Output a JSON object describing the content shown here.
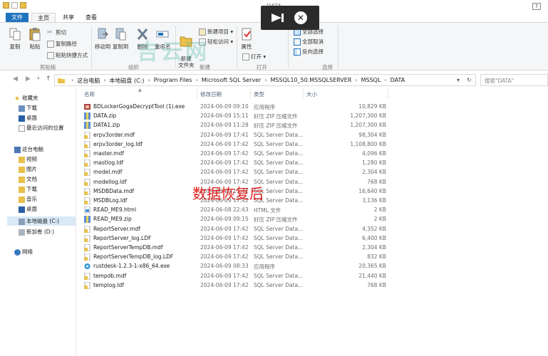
{
  "window": {
    "title": "DATA"
  },
  "ribbon_tabs": [
    "文件",
    "主页",
    "共享",
    "查看"
  ],
  "ribbon": {
    "copy": "复制",
    "paste": "粘贴",
    "cut": "剪切",
    "copy_path": "复制路径",
    "paste_shortcut": "粘贴快捷方式",
    "move_to": "移动到",
    "copy_to": "复制到",
    "delete": "删除",
    "rename": "重命名",
    "new_folder": "新建\n文件夹",
    "new_item": "新建项目",
    "easy_access": "轻松访问",
    "properties": "属性",
    "open": "打开",
    "select_all": "全部选择",
    "select_none": "全部取消",
    "invert_selection": "反向选择",
    "group_clipboard": "剪贴板",
    "group_organize": "组织",
    "group_new": "新建",
    "group_open": "打开",
    "group_select": "选择"
  },
  "overlay": {
    "close_glyph": "✕"
  },
  "watermark": "吉云网",
  "address": {
    "crumbs": [
      "这台电脑",
      "本地磁盘 (C:)",
      "Program Files",
      "Microsoft SQL Server",
      "MSSQL10_50.MSSQLSERVER",
      "MSSQL",
      "DATA"
    ],
    "search_placeholder": "搜索\"DATA\""
  },
  "nav": {
    "favorites": "收藏夹",
    "downloads": "下载",
    "desktop": "桌面",
    "recent": "最近访问的位置",
    "this_pc": "这台电脑",
    "videos": "视频",
    "pictures": "图片",
    "documents": "文档",
    "downloads2": "下载",
    "music": "音乐",
    "desktop2": "桌面",
    "local_c": "本地磁盘 (C:)",
    "new_d": "新加卷 (D:)",
    "network": "网络"
  },
  "columns": {
    "name": "名称",
    "date": "修改日期",
    "type": "类型",
    "size": "大小"
  },
  "files": [
    {
      "name": "BDLockerGogaDecryptTool (1).exe",
      "date": "2024-06-09 09:10",
      "type": "应用程序",
      "size": "10,829 KB",
      "icon": "exe"
    },
    {
      "name": "DATA.zip",
      "date": "2024-06-09 15:11",
      "type": "好压 ZIP 压缩文件",
      "size": "1,207,300 KB",
      "icon": "zip"
    },
    {
      "name": "DATA1.zip",
      "date": "2024-06-09 11:28",
      "type": "好压 ZIP 压缩文件",
      "size": "1,207,300 KB",
      "icon": "zip"
    },
    {
      "name": "erpv3order.mdf",
      "date": "2024-06-09 17:41",
      "type": "SQL Server Data...",
      "size": "98,304 KB",
      "icon": "db"
    },
    {
      "name": "erpv3order_log.ldf",
      "date": "2024-06-09 17:42",
      "type": "SQL Server Data...",
      "size": "1,108,800 KB",
      "icon": "db"
    },
    {
      "name": "master.mdf",
      "date": "2024-06-09 17:42",
      "type": "SQL Server Data...",
      "size": "4,096 KB",
      "icon": "db"
    },
    {
      "name": "mastlog.ldf",
      "date": "2024-06-09 17:42",
      "type": "SQL Server Data...",
      "size": "1,280 KB",
      "icon": "db"
    },
    {
      "name": "model.mdf",
      "date": "2024-06-09 17:42",
      "type": "SQL Server Data...",
      "size": "2,304 KB",
      "icon": "db"
    },
    {
      "name": "modellog.ldf",
      "date": "2024-06-09 17:42",
      "type": "SQL Server Data...",
      "size": "768 KB",
      "icon": "db"
    },
    {
      "name": "MSDBData.mdf",
      "date": "2024-06-09 17:42",
      "type": "SQL Server Data...",
      "size": "16,640 KB",
      "icon": "db"
    },
    {
      "name": "MSDBLog.ldf",
      "date": "2024-06-09 17:42",
      "type": "SQL Server Data...",
      "size": "3,136 KB",
      "icon": "db"
    },
    {
      "name": "READ_ME9.html",
      "date": "2024-06-08 22:43",
      "type": "HTML 文件",
      "size": "2 KB",
      "icon": "html"
    },
    {
      "name": "READ_ME9.zip",
      "date": "2024-06-09 09:15",
      "type": "好压 ZIP 压缩文件",
      "size": "2 KB",
      "icon": "zip"
    },
    {
      "name": "ReportServer.mdf",
      "date": "2024-06-09 17:42",
      "type": "SQL Server Data...",
      "size": "4,352 KB",
      "icon": "db"
    },
    {
      "name": "ReportServer_log.LDF",
      "date": "2024-06-09 17:42",
      "type": "SQL Server Data...",
      "size": "6,400 KB",
      "icon": "db"
    },
    {
      "name": "ReportServerTempDB.mdf",
      "date": "2024-06-09 17:42",
      "type": "SQL Server Data...",
      "size": "2,304 KB",
      "icon": "db"
    },
    {
      "name": "ReportServerTempDB_log.LDF",
      "date": "2024-06-09 17:42",
      "type": "SQL Server Data...",
      "size": "832 KB",
      "icon": "db"
    },
    {
      "name": "rustdesk-1.2.3-1-x86_64.exe",
      "date": "2024-06-09 08:33",
      "type": "应用程序",
      "size": "20,365 KB",
      "icon": "rust"
    },
    {
      "name": "tempdb.mdf",
      "date": "2024-06-09 17:42",
      "type": "SQL Server Data...",
      "size": "21,440 KB",
      "icon": "db"
    },
    {
      "name": "templog.ldf",
      "date": "2024-06-09 17:42",
      "type": "SQL Server Data...",
      "size": "768 KB",
      "icon": "db"
    }
  ],
  "caption": "数据恢复后",
  "colors": {
    "accent": "#1e73be",
    "caption": "#e0201e",
    "folder": "#e8c04a"
  }
}
